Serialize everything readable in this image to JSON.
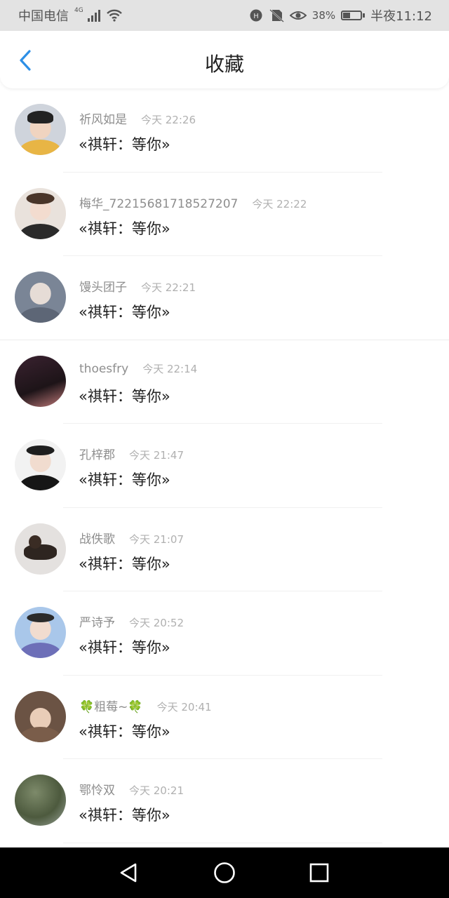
{
  "status_bar": {
    "carrier": "中国电信",
    "network": "4G",
    "battery": "38%",
    "battery_level": 0.38,
    "time": "半夜11:12",
    "icons": [
      "hd-icon",
      "no-sim-icon",
      "eye-icon",
      "wifi-icon",
      "signal-icon"
    ]
  },
  "header": {
    "back_icon": "chevron-left-icon",
    "title": "收藏",
    "accent_color": "#2d8fe6"
  },
  "favorites": [
    {
      "name": "祈风如是",
      "time": "今天 22:26",
      "message": "«祺轩：等你»"
    },
    {
      "name": "梅华_72215681718527207",
      "time": "今天 22:22",
      "message": "«祺轩：等你»"
    },
    {
      "name": "馒头团子",
      "time": "今天 22:21",
      "message": "«祺轩：等你»"
    },
    {
      "name": "thoesfry",
      "time": "今天 22:14",
      "message": "«祺轩：等你»"
    },
    {
      "name": "孔梓郡",
      "time": "今天 21:47",
      "message": "«祺轩：等你»"
    },
    {
      "name": "战佚歌",
      "time": "今天 21:07",
      "message": "«祺轩：等你»"
    },
    {
      "name": "严诗予",
      "time": "今天 20:52",
      "message": "«祺轩：等你»"
    },
    {
      "name_prefix": "🍀",
      "name": "粗莓~",
      "name_suffix": "🍀",
      "time": "今天 20:41",
      "message": "«祺轩：等你»"
    },
    {
      "name": "鄂怜双",
      "time": "今天 20:21",
      "message": "«祺轩：等你»"
    }
  ],
  "nav_bar": {
    "back_icon": "triangle-back-icon",
    "home_icon": "circle-home-icon",
    "recents_icon": "square-recents-icon"
  }
}
